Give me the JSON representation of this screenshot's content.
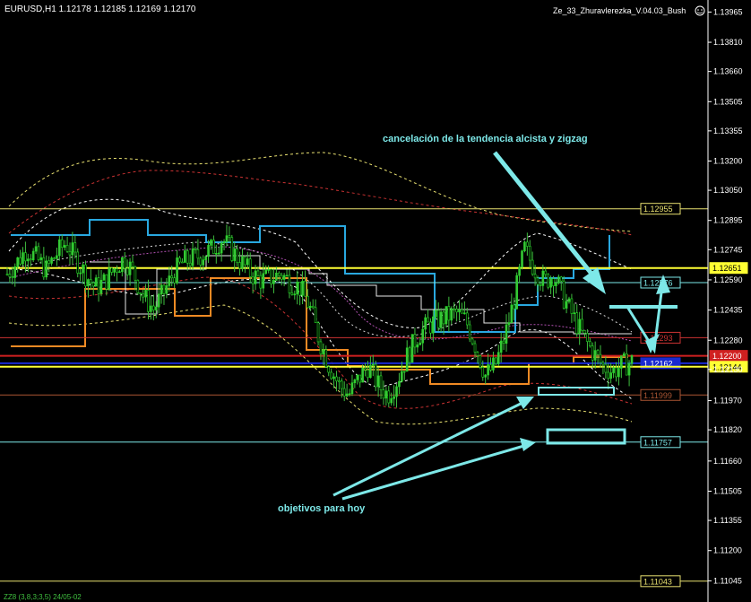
{
  "header": {
    "symbol_info": "EURUSD,H1  1.12178  1.12185  1.12169  1.12170",
    "indicator_name": "Ze_33_Zhuravlerezka_V.04.03_Bush",
    "smile_icon": "smile-icon"
  },
  "footer": {
    "label": "ZZ8 (3,8,3;3,5)  24/05-02"
  },
  "annotations": {
    "top_text": "cancelación de la tendencia alcista y zigzag",
    "bottom_text": "objetivos para hoy"
  },
  "colors": {
    "background": "#000000",
    "candle_bull": "#3fbf3f",
    "candle_bear": "#22dd22",
    "axis_text": "#ffffff",
    "annotation": "#7de8e8",
    "level_yellow": "#e8e070",
    "level_cyan": "#7de8e8",
    "level_red": "#cc3333",
    "level_brown": "#aa5533",
    "line_blue": "#29a8e0",
    "line_orange": "#f08a24",
    "line_dark_blue": "#1a2ad0",
    "line_red_solid": "#d02020"
  },
  "chart_data": {
    "type": "candlestick",
    "symbol": "EURUSD",
    "timeframe": "H1",
    "ylim": [
      1.1095,
      1.1399
    ],
    "y_ticks": [
      1.13965,
      1.1381,
      1.1366,
      1.13505,
      1.13355,
      1.132,
      1.1305,
      1.12895,
      1.12745,
      1.1259,
      1.12435,
      1.1228,
      1.1213,
      1.1197,
      1.1182,
      1.1166,
      1.11505,
      1.11355,
      1.112,
      1.11045
    ],
    "levels": [
      {
        "value": 1.12955,
        "label": "1.12955",
        "style": "yellow"
      },
      {
        "value": 1.12651,
        "label": "1.12651",
        "style": "yellow_filled"
      },
      {
        "value": 1.12576,
        "label": "1.12576",
        "style": "cyan"
      },
      {
        "value": 1.12293,
        "label": "1.12293",
        "style": "red"
      },
      {
        "value": 1.122,
        "label": "1.12200",
        "style": "red_filled"
      },
      {
        "value": 1.12162,
        "label": "1.12162",
        "style": "blue_filled"
      },
      {
        "value": 1.12144,
        "label": "1.12144",
        "style": "yellow_filled"
      },
      {
        "value": 1.11999,
        "label": "1.11999",
        "style": "brown"
      },
      {
        "value": 1.11757,
        "label": "1.11757",
        "style": "cyan"
      },
      {
        "value": 1.11043,
        "label": "1.11043",
        "style": "yellow"
      }
    ],
    "close_path": [
      1.1262,
      1.1268,
      1.1275,
      1.127,
      1.1264,
      1.1272,
      1.1278,
      1.127,
      1.1262,
      1.1255,
      1.1258,
      1.1265,
      1.127,
      1.1262,
      1.125,
      1.1244,
      1.1252,
      1.1262,
      1.1268,
      1.127,
      1.1272,
      1.1275,
      1.128,
      1.1274,
      1.1268,
      1.1262,
      1.1259,
      1.126,
      1.1262,
      1.1258,
      1.1255,
      1.1245,
      1.1228,
      1.1215,
      1.1205,
      1.12,
      1.1208,
      1.1215,
      1.1205,
      1.12,
      1.1208,
      1.122,
      1.123,
      1.1235,
      1.1238,
      1.124,
      1.1242,
      1.1238,
      1.1225,
      1.121,
      1.1215,
      1.123,
      1.125,
      1.1275,
      1.1265,
      1.1258,
      1.1262,
      1.125,
      1.124,
      1.123,
      1.1222,
      1.1215,
      1.1212,
      1.1215,
      1.1217
    ],
    "targets": [
      1.12,
      1.1176
    ]
  }
}
